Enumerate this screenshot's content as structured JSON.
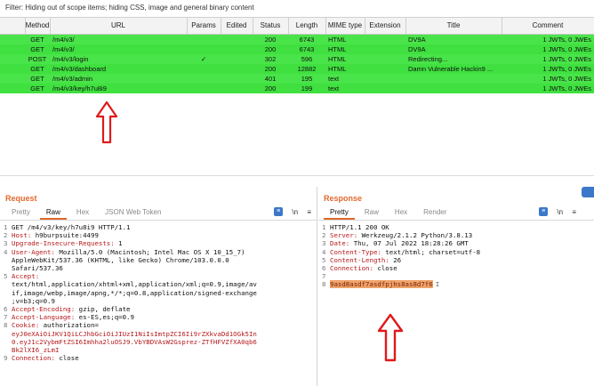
{
  "filter": {
    "text": "Filter: Hiding out of scope items;  hiding CSS, image and general binary content"
  },
  "table": {
    "columns": [
      "",
      "Method",
      "URL",
      "Params",
      "Edited",
      "Status",
      "Length",
      "MIME type",
      "Extension",
      "Title",
      "Comment"
    ],
    "rows": [
      {
        "method": "GET",
        "url": "/m4/v3/",
        "params": "",
        "status": "200",
        "length": "6743",
        "mime": "HTML",
        "title": "DV9A",
        "comment": "1 JWTs, 0 JWEs"
      },
      {
        "method": "GET",
        "url": "/m4/v3/",
        "params": "",
        "status": "200",
        "length": "6743",
        "mime": "HTML",
        "title": "DV9A",
        "comment": "1 JWTs, 0 JWEs"
      },
      {
        "method": "POST",
        "url": "/m4/v3/login",
        "params": "✓",
        "status": "302",
        "length": "596",
        "mime": "HTML",
        "title": "Redirecting...",
        "comment": "1 JWTs, 0 JWEs"
      },
      {
        "method": "GET",
        "url": "/m4/v3/dashboard",
        "params": "",
        "status": "200",
        "length": "12882",
        "mime": "HTML",
        "title": "Damn Vulnerable Hackin9 ...",
        "comment": "1 JWTs, 0 JWEs"
      },
      {
        "method": "GET",
        "url": "/m4/v3/admin",
        "params": "",
        "status": "401",
        "length": "195",
        "mime": "text",
        "title": "",
        "comment": "1 JWTs, 0 JWEs"
      },
      {
        "method": "GET",
        "url": "/m4/v3/key/h7u8i9",
        "params": "",
        "status": "200",
        "length": "199",
        "mime": "text",
        "title": "",
        "comment": "1 JWTs, 0 JWEs"
      }
    ]
  },
  "request": {
    "title": "Request",
    "tabs": [
      "Pretty",
      "Raw",
      "Hex",
      "JSON Web Token"
    ],
    "active_tab": "Raw",
    "icons": [
      "list-icon",
      "newline-icon",
      "menu-icon"
    ],
    "icon_glyphs": {
      "newline": "\\n",
      "menu": "≡"
    },
    "lines": [
      {
        "n": "1",
        "text": "GET /m4/v3/key/h7u8i9 HTTP/1.1"
      },
      {
        "n": "2",
        "key": "Host:",
        "value": " h9burpsuite:4499"
      },
      {
        "n": "3",
        "key": "Upgrade-Insecure-Requests:",
        "value": " 1"
      },
      {
        "n": "4",
        "key": "User-Agent:",
        "value": " Mozilla/5.0 (Macintosh; Intel Mac OS X 10_15_7)"
      },
      {
        "n": "",
        "text": "AppleWebKit/537.36 (KHTML, like Gecko) Chrome/103.0.0.0"
      },
      {
        "n": "",
        "text": "Safari/537.36"
      },
      {
        "n": "5",
        "key": "Accept:",
        "value": ""
      },
      {
        "n": "",
        "text": "text/html,application/xhtml+xml,application/xml;q=0.9,image/av"
      },
      {
        "n": "",
        "text": "if,image/webp,image/apng,*/*;q=0.8,application/signed-exchange"
      },
      {
        "n": "",
        "text": ";v=b3;q=0.9"
      },
      {
        "n": "6",
        "key": "Accept-Encoding:",
        "value": " gzip, deflate"
      },
      {
        "n": "7",
        "key": "Accept-Language:",
        "value": " es-ES,es;q=0.9"
      },
      {
        "n": "8",
        "key": "Cookie:",
        "value": " authorization="
      },
      {
        "n": "",
        "token": "eyJ0eXAiOiJKV1QiLCJhbGciOiJIUzI1NiIsImtpZCI6Ii9rZXkvaDd1OGk5In"
      },
      {
        "n": "",
        "token": "0.eyJ1c2VybmFtZSI6Imhha2luOSJ9.VbYBDVAsW2Gsprez-ZTfHFVZfXA0qb6"
      },
      {
        "n": "",
        "token": "Bk2lXI6_zLmI"
      },
      {
        "n": "9",
        "key": "Connection:",
        "value": " close"
      }
    ]
  },
  "response": {
    "title": "Response",
    "tabs": [
      "Pretty",
      "Raw",
      "Hex",
      "Render"
    ],
    "active_tab": "Pretty",
    "icons": [
      "list-icon",
      "newline-icon",
      "menu-icon"
    ],
    "icon_glyphs": {
      "newline": "\\n",
      "menu": "≡"
    },
    "lines": [
      {
        "n": "1",
        "text": "HTTP/1.1 200 OK"
      },
      {
        "n": "2",
        "key": "Server:",
        "value": " Werkzeug/2.1.2 Python/3.8.13"
      },
      {
        "n": "3",
        "key": "Date:",
        "value": " Thu, 07 Jul 2022 18:28:26 GMT"
      },
      {
        "n": "4",
        "key": "Content-Type:",
        "value": " text/html; charset=utf-8"
      },
      {
        "n": "5",
        "key": "Content-Length:",
        "value": " 26"
      },
      {
        "n": "6",
        "key": "Connection:",
        "value": " close"
      },
      {
        "n": "7",
        "text": ""
      },
      {
        "n": "8",
        "highlight": "9asd8asdf7asdfpjhs8as8d7f6"
      }
    ]
  }
}
